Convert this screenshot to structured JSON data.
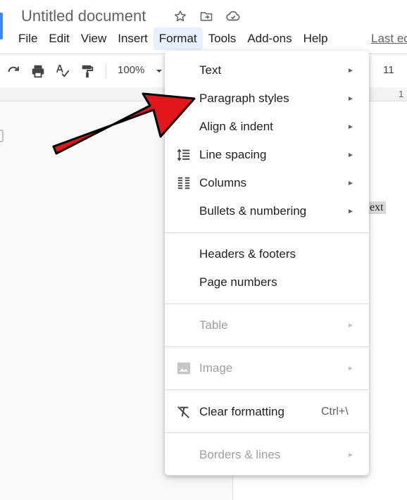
{
  "header": {
    "title": "Untitled document",
    "last_edit": "Last ed",
    "title_icons": [
      "star-icon",
      "move-to-folder-icon",
      "cloud-status-icon"
    ]
  },
  "menubar": {
    "items": [
      {
        "label": "File"
      },
      {
        "label": "Edit"
      },
      {
        "label": "View"
      },
      {
        "label": "Insert"
      },
      {
        "label": "Format"
      },
      {
        "label": "Tools"
      },
      {
        "label": "Add-ons"
      },
      {
        "label": "Help"
      }
    ]
  },
  "toolbar": {
    "zoom": "100%",
    "font_size": "11",
    "icons": [
      "redo-icon",
      "print-icon",
      "spellcheck-icon",
      "paint-format-icon",
      "zoom-dropdown-icon"
    ]
  },
  "ruler": {
    "number": "1"
  },
  "document": {
    "body_text": "ext"
  },
  "format_menu": {
    "items": [
      {
        "label": "Text",
        "submenu": true,
        "icon": ""
      },
      {
        "label": "Paragraph styles",
        "submenu": true,
        "icon": ""
      },
      {
        "label": "Align & indent",
        "submenu": true,
        "icon": ""
      },
      {
        "label": "Line spacing",
        "submenu": true,
        "icon": "line-spacing-icon"
      },
      {
        "label": "Columns",
        "submenu": true,
        "icon": "columns-icon"
      },
      {
        "label": "Bullets & numbering",
        "submenu": true,
        "icon": ""
      },
      {
        "label": "Headers & footers",
        "submenu": false,
        "icon": ""
      },
      {
        "label": "Page numbers",
        "submenu": false,
        "icon": ""
      },
      {
        "label": "Table",
        "submenu": true,
        "disabled": true,
        "icon": ""
      },
      {
        "label": "Image",
        "submenu": true,
        "disabled": true,
        "icon": "image-icon"
      },
      {
        "label": "Clear formatting",
        "submenu": false,
        "shortcut": "Ctrl+\\",
        "icon": "clear-formatting-icon"
      },
      {
        "label": "Borders & lines",
        "submenu": true,
        "disabled": true,
        "icon": ""
      }
    ]
  },
  "colors": {
    "accent": "#e8f0fe",
    "annotation_arrow": "#e3161b",
    "doc_blue": "#4285f4"
  }
}
